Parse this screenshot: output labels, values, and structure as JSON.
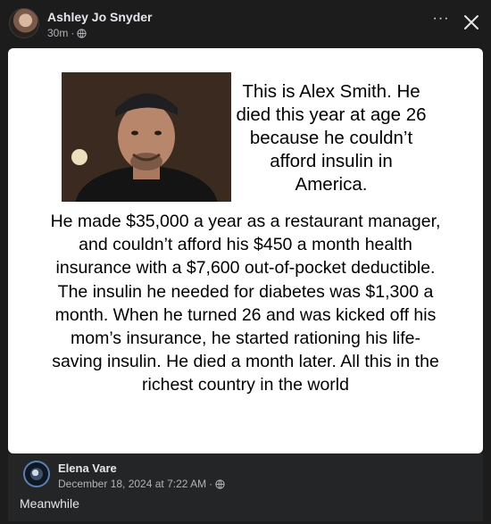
{
  "post": {
    "author": "Ashley Jo Snyder",
    "time": "30m",
    "separator": "·",
    "privacy_icon": "globe-icon",
    "more_icon": "more-horizontal-icon",
    "more_label": "···",
    "close_icon": "close-icon"
  },
  "meme": {
    "headline": "This is Alex Smith. He died this year at age 26 because he couldn’t afford insulin in America.",
    "body": "He made $35,000 a year as a restaurant manager, and couldn’t afford his $450 a month health insurance with a $7,600 out-of-pocket deductible. The insulin he needed for diabetes was $1,300 a month. When he turned 26 and was kicked off his mom’s insurance, he started rationing his life-saving insulin. He died a month later. All this in the richest country in the world"
  },
  "shared": {
    "author": "Elena Vare",
    "time": "December 18, 2024 at 7:22 AM",
    "separator": "·",
    "privacy_icon": "globe-icon",
    "caption": "Meanwhile"
  }
}
